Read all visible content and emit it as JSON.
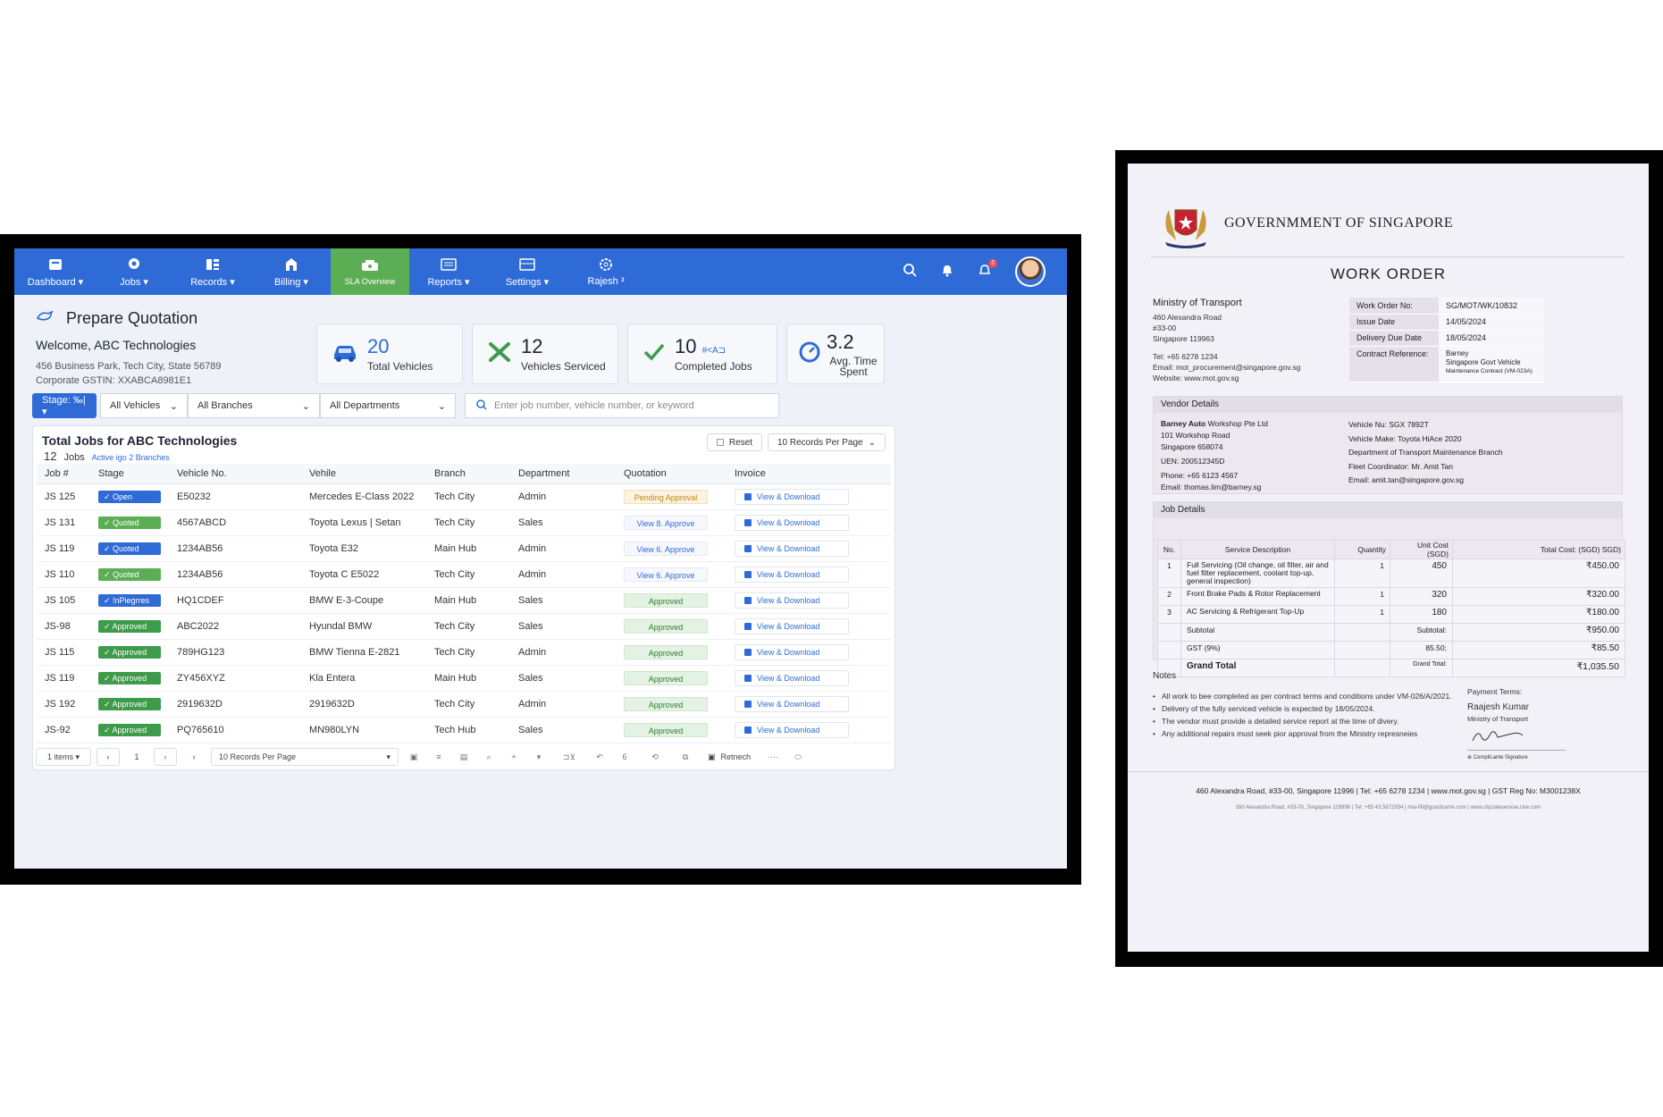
{
  "nav": {
    "items": [
      {
        "label": "Dashboard ▾",
        "icon": "dashboard-icon"
      },
      {
        "label": "Jobs ▾",
        "icon": "jobs-icon"
      },
      {
        "label": "Records ▾",
        "icon": "records-icon"
      },
      {
        "label": "Billing ▾",
        "icon": "billing-icon"
      },
      {
        "label": "SLA Overview",
        "icon": "sla-icon"
      },
      {
        "label": "Reports ▾",
        "icon": "reports-icon"
      },
      {
        "label": "Settings ▾",
        "icon": "settings-icon"
      },
      {
        "label": "Rajesh ³",
        "icon": "gear-icon"
      }
    ],
    "notification_count": "3",
    "accent": "#2f6bd6",
    "active_color": "#5cae55"
  },
  "page": {
    "title": "Prepare Quotation",
    "welcome": "Welcome, ABC Technologies",
    "address": "456 Business Park, Tech City, State 56789",
    "gstin": "Corporate GSTIN: XXABCA8981E1"
  },
  "stats": [
    {
      "value": "20",
      "label": "Total Vehicles"
    },
    {
      "value": "12",
      "label": "Vehicles Serviced"
    },
    {
      "value": "10",
      "extra": "#<A⊐",
      "label": "Completed Jobs"
    },
    {
      "value": "3.2",
      "label": "Avg. Time Spent"
    }
  ],
  "filters": {
    "stage": "Stage: ‰| ▾",
    "vehicles": "All Vehicles",
    "branches": "All Branches",
    "departments": "All Departments",
    "search_placeholder": "Enter job number, vehicle number, or keyword"
  },
  "table": {
    "title": "Total Jobs for ABC Technologies",
    "count": "12",
    "count_label": "Jobs",
    "sub": "Active igo 2 Branches",
    "reset": "Reset",
    "per_page": "10 Records Per Page",
    "headers": [
      "Job #",
      "Stage",
      "Vehicle No.",
      "Vehile",
      "Branch",
      "Department",
      "Quotation",
      "Invoice"
    ],
    "rows": [
      {
        "job": "JS 125",
        "stage": "✓ Open",
        "stage_type": "open",
        "vno": "E50232",
        "vehicle": "Mercedes E-Class 2022",
        "branch": "Tech City",
        "dept": "Admin",
        "quote": "Pending Approval",
        "quote_type": "pending",
        "invoice": "View & Download"
      },
      {
        "job": "JS 131",
        "stage": "✓ Quoted",
        "stage_type": "quoted",
        "vno": "4567ABCD",
        "vehicle": "Toyota Lexus | Setan",
        "branch": "Tech City",
        "dept": "Sales",
        "quote": "View 8. Approve",
        "quote_type": "view",
        "invoice": "View & Download"
      },
      {
        "job": "JS 119",
        "stage": "✓ Quoted",
        "stage_type": "quotedb",
        "vno": "1234AB56",
        "vehicle": "Toyota E32",
        "branch": "Main Hub",
        "dept": "Admin",
        "quote": "View 6. Approve",
        "quote_type": "view",
        "invoice": "View & Download"
      },
      {
        "job": "JS 110",
        "stage": "✓ Quoted",
        "stage_type": "quoted",
        "vno": "1234AB56",
        "vehicle": "Toyota C E5022",
        "branch": "Tech City",
        "dept": "Admin",
        "quote": "View 6. Approve",
        "quote_type": "view",
        "invoice": "View & Download"
      },
      {
        "job": "JS 105",
        "stage": "✓ !nPiegrres",
        "stage_type": "inprog",
        "vno": "HQ1CDEF",
        "vehicle": "BMW E-3-Coupe",
        "branch": "Main Hub",
        "dept": "Sales",
        "quote": "Approved",
        "quote_type": "approved",
        "invoice": "View & Download"
      },
      {
        "job": "JS-98",
        "stage": "✓ Approved",
        "stage_type": "approved",
        "vno": "ABC2022",
        "vehicle": "Hyundal BMW",
        "branch": "Tech City",
        "dept": "Sales",
        "quote": "Approved",
        "quote_type": "approved",
        "invoice": "View & Download"
      },
      {
        "job": "JS 115",
        "stage": "✓ Approved",
        "stage_type": "approved",
        "vno": "789HG123",
        "vehicle": "BMW Tienna E-2821",
        "branch": "Tech City",
        "dept": "Admin",
        "quote": "Approved",
        "quote_type": "approved",
        "invoice": "View & Download"
      },
      {
        "job": "JS 119",
        "stage": "✓ Approved",
        "stage_type": "approved",
        "vno": "ZY456XYZ",
        "vehicle": "Kla Entera",
        "branch": "Main Hub",
        "dept": "Sales",
        "quote": "Approved",
        "quote_type": "approved",
        "invoice": "View & Download"
      },
      {
        "job": "JS 192",
        "stage": "✓ Approved",
        "stage_type": "approved",
        "vno": "2919632D",
        "vehicle": "2919632D",
        "branch": "Tech City",
        "dept": "Admin",
        "quote": "Approved",
        "quote_type": "approved",
        "invoice": "View & Download"
      },
      {
        "job": "JS-92",
        "stage": "✓ Approved",
        "stage_type": "approved",
        "vno": "PQ765610",
        "vehicle": "MN980LYN",
        "branch": "Tech Hub",
        "dept": "Sales",
        "quote": "Approved",
        "quote_type": "approved",
        "invoice": "View & Download"
      }
    ]
  },
  "pager": {
    "items": "1 items ▾",
    "page": "1",
    "per_page": "10 Records Per Page",
    "count": "6",
    "refresh": "Retnech",
    "more": "····"
  },
  "doc": {
    "gov": "GOVERNMMENT OF SINGAPORE",
    "title": "WORK ORDER",
    "ministry": "Ministry of Transport",
    "addr1": "460 Alexandra Road",
    "addr2": "#33-00",
    "addr3": "Singapore 119963",
    "tel": "Tel: +65 6278 1234",
    "email": "Email: mot_procurement@singapore.gov.sg",
    "web": "Website: www.mot.gov.sg",
    "wo_rows": [
      {
        "k": "Work Order No:",
        "v": "SG/MOT/WK/10832"
      },
      {
        "k": "Issue Date",
        "v": "14/05/2024"
      },
      {
        "k": "Delivery Due Date",
        "v": "18/05/2024"
      },
      {
        "k": "Contract Reference:",
        "v": "Barney"
      }
    ],
    "contract_sub1": "Singapore Govt Vehicle",
    "contract_sub2": "Maintenance Contract (VM-023A)",
    "vendor_h": "Vendor Details",
    "vendor_name_b": "Barney Auto",
    "vendor_name": " Workshop Pte Ltd",
    "vendor_addr1": "101 Workshop Road",
    "vendor_addr2": "Singapore 658074",
    "vendor_uen": "UEN: 200512345D",
    "vendor_phone": "Phone: +65 6123 4567",
    "vendor_email": "Email: thomas.lim@barney.sg",
    "vehicle_no": "Vehicle Nu:  SGX 7892T",
    "vehicle_make": "Vehicle Make: Toyota HiAce 2020",
    "dept": "Department of Transport Maintenance Branch",
    "fleet": "Fleet Coordinator: Mr. Amit Tan",
    "fleet_email": "Email: amit.tan@singapore.gov.sg",
    "job_h": "Job Details",
    "job_headers": [
      "No.",
      "Service Description",
      "Quantity",
      "Unit Cost (SGD)",
      "Total Cost: (SGD) SGD)"
    ],
    "jobs": [
      {
        "no": "1",
        "desc": "Full Servicing (Oil change, oil filter, air and fuel filter replacement, coolant top-up, general inspection)",
        "qty": "1",
        "unit": "450",
        "total": "₹450.00"
      },
      {
        "no": "2",
        "desc": "Front Brake Pads & Rotor Replacement",
        "qty": "1",
        "unit": "320",
        "total": "₹320.00"
      },
      {
        "no": "3",
        "desc": "AC Servicing & Refrigerant Top-Up",
        "qty": "1",
        "unit": "180",
        "total": "₹180.00"
      }
    ],
    "subtotal_l": "Subtotal",
    "subtotal_l2": "Subtotal:",
    "subtotal": "₹950.00",
    "gst_l": "GST (9%)",
    "gst_mid": "85.50;",
    "gst": "₹85.50",
    "grand_l": "Grand Total",
    "grand_l2": "Grand Total:",
    "grand": "₹1,035.50",
    "notes_h": "Notes",
    "notes": [
      "All work to bee completed as per contract terms and conditions under VM-026/A/2021.",
      "Delivery of the fully serviced vehicle is expected by 18/05/2024.",
      "The vendor must provide a detailed service report at the time of divery.",
      "Any additional repairs must seek pior approval from the Ministry represneies"
    ],
    "pay_terms": "Payment Terms:",
    "signer": "Raajesh Kumar",
    "signer_org": "Ministry of Transport",
    "sig_label": "⊕ CompliLante Signature",
    "footer": "460 Alexandra Road, #33-00, Singapore 11996  |  Tel: +65 6278 1234  |  www.mot.gov.sg  |  GST Reg No: M3001238X",
    "footer2": "160 Alexandra Road, #33-00, Singapore 119996 | Tel: +65 43.5672934 | mai-fifi@grasbcerre.com | www.cityzaleservise.clve.com"
  }
}
